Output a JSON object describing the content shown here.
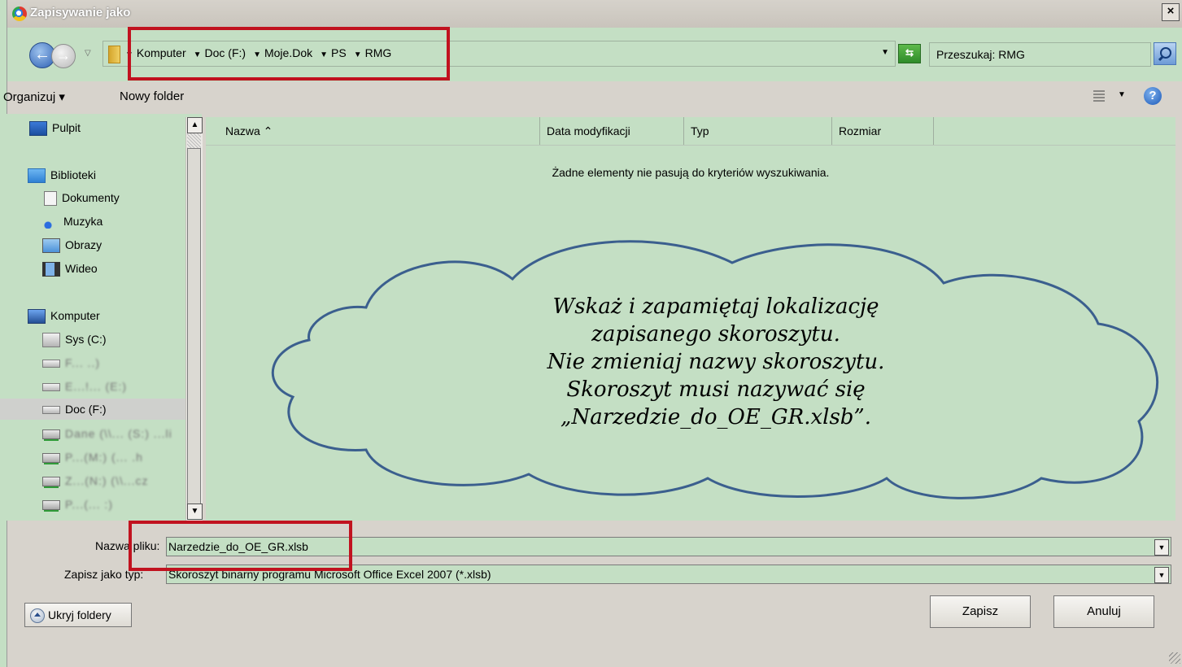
{
  "window": {
    "title": "Zapisywanie jako",
    "close_label": "×"
  },
  "address": {
    "crumbs": [
      "Komputer",
      "Doc (F:)",
      "Moje.Dok",
      "PS",
      "RMG"
    ],
    "search_value": "Przeszukaj: RMG"
  },
  "toolbar": {
    "organize_label": "Organizuj ▾",
    "new_folder_label": "Nowy folder",
    "help_label": "?"
  },
  "nav": {
    "items": [
      {
        "label": "Pulpit"
      },
      {
        "label": "Biblioteki"
      },
      {
        "label": "Dokumenty"
      },
      {
        "label": "Muzyka"
      },
      {
        "label": "Obrazy"
      },
      {
        "label": "Wideo"
      },
      {
        "label": "Komputer"
      },
      {
        "label": "Sys (C:)"
      },
      {
        "label": "F... ..)"
      },
      {
        "label": "E...!... (E:)"
      },
      {
        "label": "Doc (F:)"
      },
      {
        "label": "Dane (\\\\... (S:) ...li"
      },
      {
        "label": "P...(M:) (... .h"
      },
      {
        "label": "Z...(N:) (\\\\...cz"
      },
      {
        "label": "P...(... :)"
      }
    ]
  },
  "files": {
    "columns": [
      "Nazwa ⌃",
      "Data modyfikacji",
      "Typ",
      "Rozmiar"
    ],
    "empty_message": "Żadne elementy nie pasują do kryteriów wyszukiwania."
  },
  "callout": {
    "lines": [
      "Wskaż i zapamiętaj lokalizację",
      "zapisanego skoroszytu.",
      "Nie zmieniaj nazwy skoroszytu.",
      "Skoroszyt musi nazywać się",
      "„Narzedzie_do_OE_GR.xlsb”."
    ]
  },
  "form": {
    "filename_label": "Nazwa pliku:",
    "filename_value": "Narzedzie_do_OE_GR.xlsb",
    "filetype_label": "Zapisz jako typ:",
    "filetype_value": "Skoroszyt binarny programu Microsoft Office Excel 2007 (*.xlsb)"
  },
  "buttons": {
    "hide_folders": "Ukryj foldery",
    "save": "Zapisz",
    "cancel": "Anuluj"
  },
  "colors": {
    "field_bg": "#c4dfc4",
    "highlight_red": "#c1121f",
    "cloud_stroke": "#3b5f8e"
  }
}
